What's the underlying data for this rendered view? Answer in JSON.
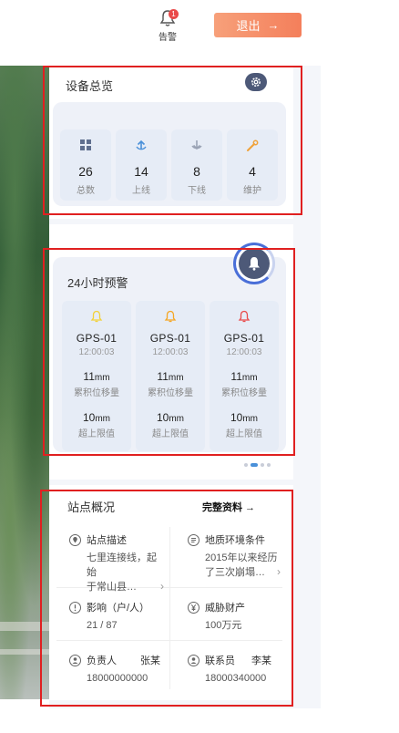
{
  "header": {
    "alarm_label": "告警",
    "alarm_badge": "1",
    "logout_label": "退出",
    "logout_arrow": "→"
  },
  "overview": {
    "title": "设备总览",
    "items": [
      {
        "icon": "grid-icon",
        "value": "26",
        "label": "总数",
        "color": "#5f6f8f"
      },
      {
        "icon": "upload-icon",
        "value": "14",
        "label": "上线",
        "color": "#4a90d9"
      },
      {
        "icon": "download-icon",
        "value": "8",
        "label": "下线",
        "color": "#9aa3b5"
      },
      {
        "icon": "wrench-icon",
        "value": "4",
        "label": "维护",
        "color": "#f0a23a"
      }
    ]
  },
  "warnings": {
    "title": "24小时预警",
    "items": [
      {
        "bell_color": "#f2d13a",
        "name": "GPS-01",
        "time": "12:00:03",
        "disp_value": "11",
        "disp_unit": "mm",
        "disp_label": "累积位移量",
        "limit_value": "10",
        "limit_unit": "mm",
        "limit_label": "超上限值"
      },
      {
        "bell_color": "#f5a623",
        "name": "GPS-01",
        "time": "12:00:03",
        "disp_value": "11",
        "disp_unit": "mm",
        "disp_label": "累积位移量",
        "limit_value": "10",
        "limit_unit": "mm",
        "limit_label": "超上限值"
      },
      {
        "bell_color": "#e94a4a",
        "name": "GPS-01",
        "time": "12:00:03",
        "disp_value": "11",
        "disp_unit": "mm",
        "disp_label": "累积位移量",
        "limit_value": "10",
        "limit_unit": "mm",
        "limit_label": "超上限值"
      }
    ]
  },
  "station": {
    "title": "站点概况",
    "link_label": "完整资料 →",
    "description_label": "站点描述",
    "description_line1": "七里连接线，起始",
    "description_line2": "于常山县…",
    "geo_label": "地质环境条件",
    "geo_line1": "2015年以来经历",
    "geo_line2": "了三次崩塌…",
    "impact_label": "影响（户/人）",
    "impact_value": "21 / 87",
    "property_label": "威胁财产",
    "property_value": "100万元",
    "owner_label": "负责人",
    "owner_name": "张某",
    "owner_phone": "18000000000",
    "contact_label": "联系员",
    "contact_name": "李某",
    "contact_phone": "18000340000"
  },
  "colors": {
    "accent": "#4a6fd8",
    "highlight_border": "#e02020",
    "logout_gradient_start": "#f7a07a",
    "logout_gradient_end": "#f47f5b"
  }
}
